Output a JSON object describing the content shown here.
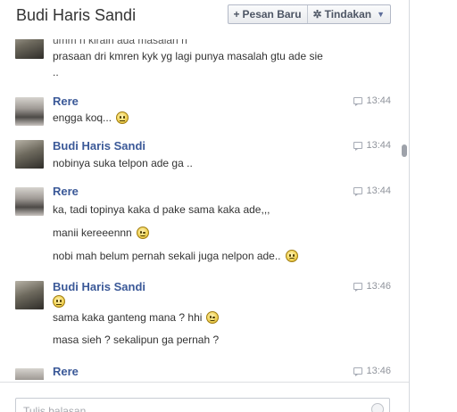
{
  "header": {
    "title": "Budi Haris Sandi",
    "new_message_label": "Pesan Baru",
    "actions_label": "Tindakan"
  },
  "thread": {
    "cut_top_text": "umm n kirain ada masalah n",
    "groups": [
      {
        "sender": "",
        "time": "",
        "messages": [
          "prasaan dri kmren kyk yg lagi punya masalah gtu ade sie",
          ".."
        ]
      },
      {
        "sender": "Rere",
        "time": "13:44",
        "messages": [
          "engga koq..."
        ]
      },
      {
        "sender": "Budi Haris Sandi",
        "time": "13:44",
        "messages": [
          "nobinya suka telpon ade ga .."
        ]
      },
      {
        "sender": "Rere",
        "time": "13:44",
        "messages": [
          "ka, tadi topinya kaka d pake sama kaka ade,,,",
          "manii kereeennn",
          "nobi mah belum pernah sekali juga nelpon ade.."
        ]
      },
      {
        "sender": "Budi Haris Sandi",
        "time": "13:46",
        "messages": [
          "sama kaka ganteng mana ? hhi",
          "masa sieh ? sekalipun ga pernah ?"
        ]
      },
      {
        "sender": "Rere",
        "time": "13:46",
        "messages": []
      }
    ]
  },
  "composer": {
    "placeholder": "Tulis balasan..."
  }
}
